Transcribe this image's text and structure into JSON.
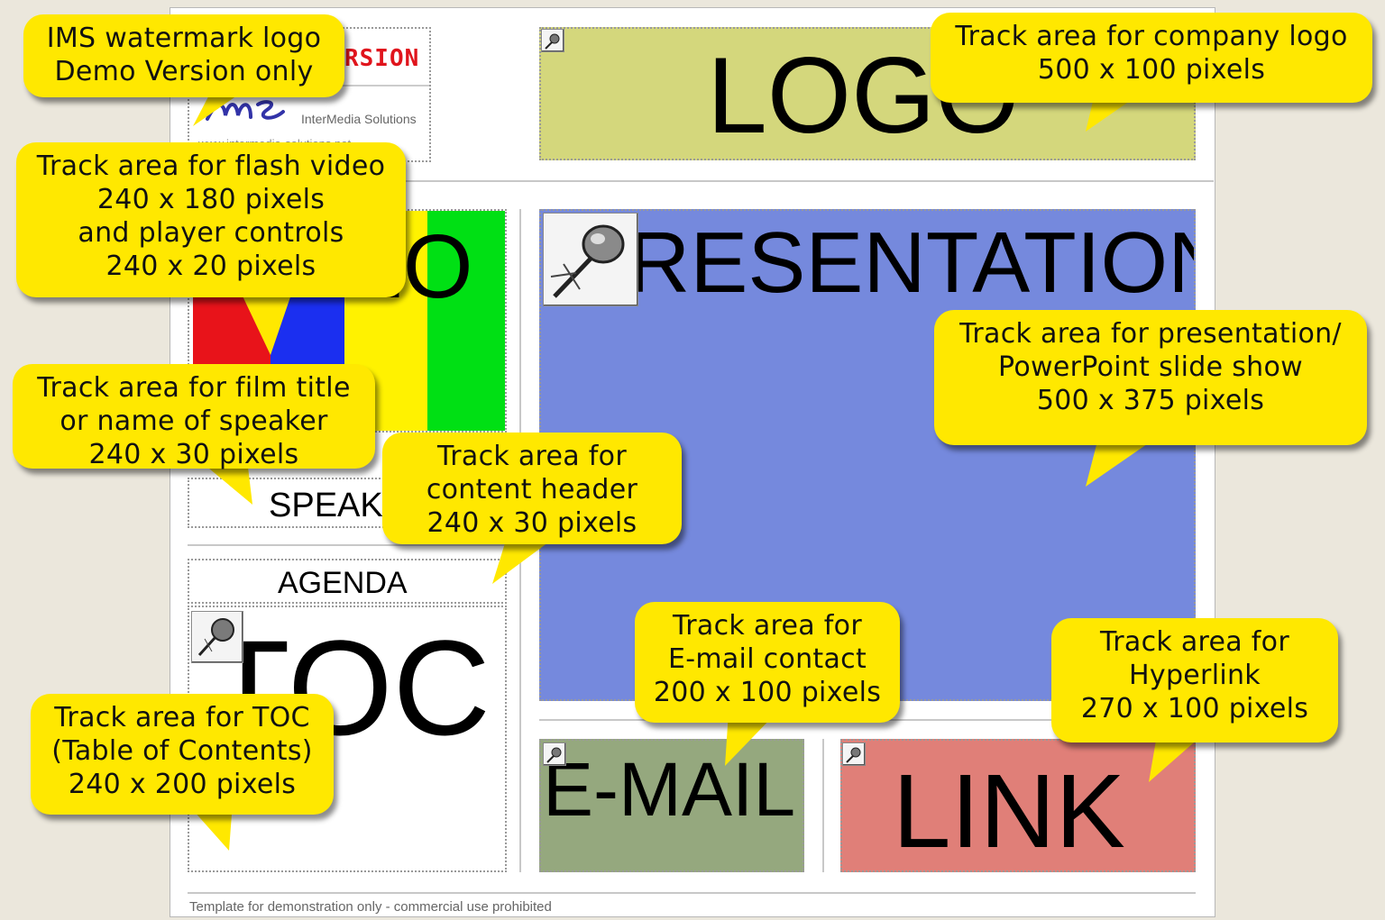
{
  "layout": {
    "watermark": {
      "text_partial": "RSION",
      "brand": "InterMedia Solutions",
      "url_partial": "www.intermedia-solutions.net"
    },
    "logo_zone": {
      "label": "LOGO"
    },
    "video_zone": {
      "label": "EO",
      "colors": [
        "#e8131a",
        "#1b2ff0",
        "#fff200",
        "#00e014"
      ]
    },
    "speaker_zone": {
      "label": "SPEAK"
    },
    "agenda_zone": {
      "label": "AGENDA"
    },
    "toc_zone": {
      "label": "TOC"
    },
    "presentation_zone": {
      "label": "RESENTATION",
      "color": "#7589dd"
    },
    "email_zone": {
      "label": "E-MAIL",
      "color": "#95a87e"
    },
    "link_zone": {
      "label": "LINK",
      "color": "#e07f78"
    },
    "footer": "Template for demonstration only - commercial use prohibited"
  },
  "callouts": {
    "watermark": [
      "IMS watermark logo",
      "Demo Version only"
    ],
    "logo": [
      "Track area for company logo",
      "500 x 100 pixels"
    ],
    "video": [
      "Track area for flash video",
      "240 x 180 pixels",
      "and player controls",
      "240 x 20 pixels"
    ],
    "presentation": [
      "Track area for presentation/",
      "PowerPoint slide show",
      "500 x 375 pixels"
    ],
    "film_title": [
      "Track area for film title",
      "or name of speaker",
      "240 x 30 pixels"
    ],
    "content_header": [
      "Track area for",
      "content header",
      "240 x 30 pixels"
    ],
    "email": [
      "Track area for",
      "E-mail contact",
      "200 x 100 pixels"
    ],
    "hyperlink": [
      "Track area for",
      "Hyperlink",
      "270 x 100 pixels"
    ],
    "toc": [
      "Track area for TOC",
      "(Table of Contents)",
      "240 x 200 pixels"
    ]
  },
  "colors": {
    "callout": "#ffe800",
    "logo_zone": "#d4d77c",
    "background": "#ebe7dc"
  }
}
